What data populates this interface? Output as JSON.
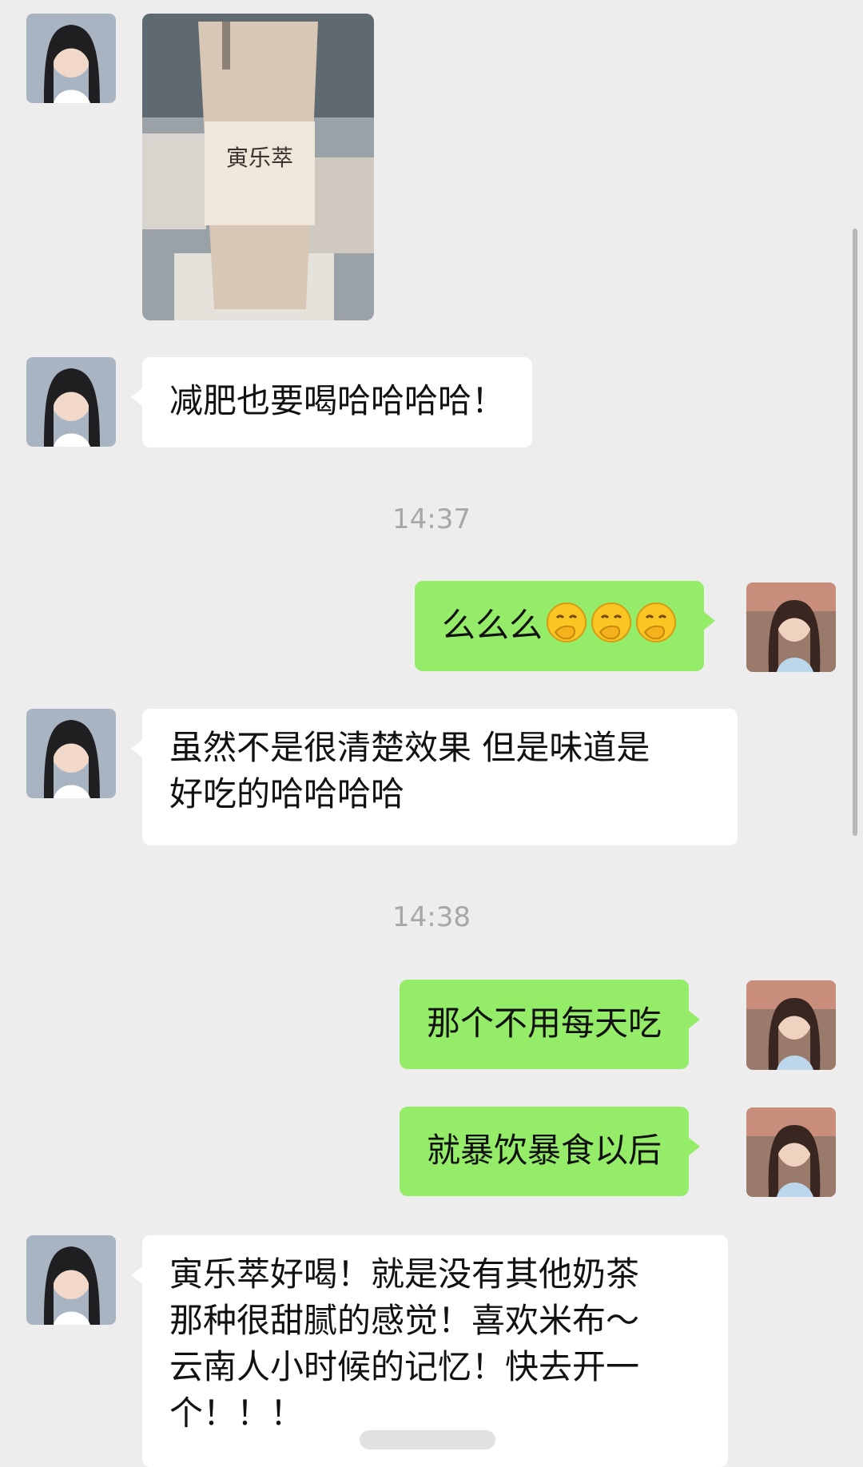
{
  "messages": [
    {
      "sender": "other",
      "type": "image",
      "caption": ""
    },
    {
      "sender": "other",
      "type": "text",
      "text": "减肥也要喝哈哈哈哈！"
    },
    {
      "type": "timestamp",
      "text": "14:37"
    },
    {
      "sender": "me",
      "type": "text",
      "text": "么么么",
      "emoji": [
        "hand-over-mouth-emoji",
        "hand-over-mouth-emoji",
        "hand-over-mouth-emoji"
      ]
    },
    {
      "sender": "other",
      "type": "text",
      "lines": [
        "虽然不是很清楚效果 但是味道是",
        "好吃的哈哈哈哈"
      ]
    },
    {
      "type": "timestamp",
      "text": "14:38"
    },
    {
      "sender": "me",
      "type": "text",
      "text": "那个不用每天吃"
    },
    {
      "sender": "me",
      "type": "text",
      "text": "就暴饮暴食以后"
    },
    {
      "sender": "other",
      "type": "text",
      "lines": [
        "寅乐萃好喝！就是没有其他奶茶",
        "那种很甜腻的感觉！喜欢米布～",
        "云南人小时候的记忆！快去开一",
        "个！！！"
      ]
    }
  ],
  "colors": {
    "background": "#ededed",
    "bubble_other": "#ffffff",
    "bubble_me": "#95ec69",
    "timestamp": "#a7a7a7"
  }
}
